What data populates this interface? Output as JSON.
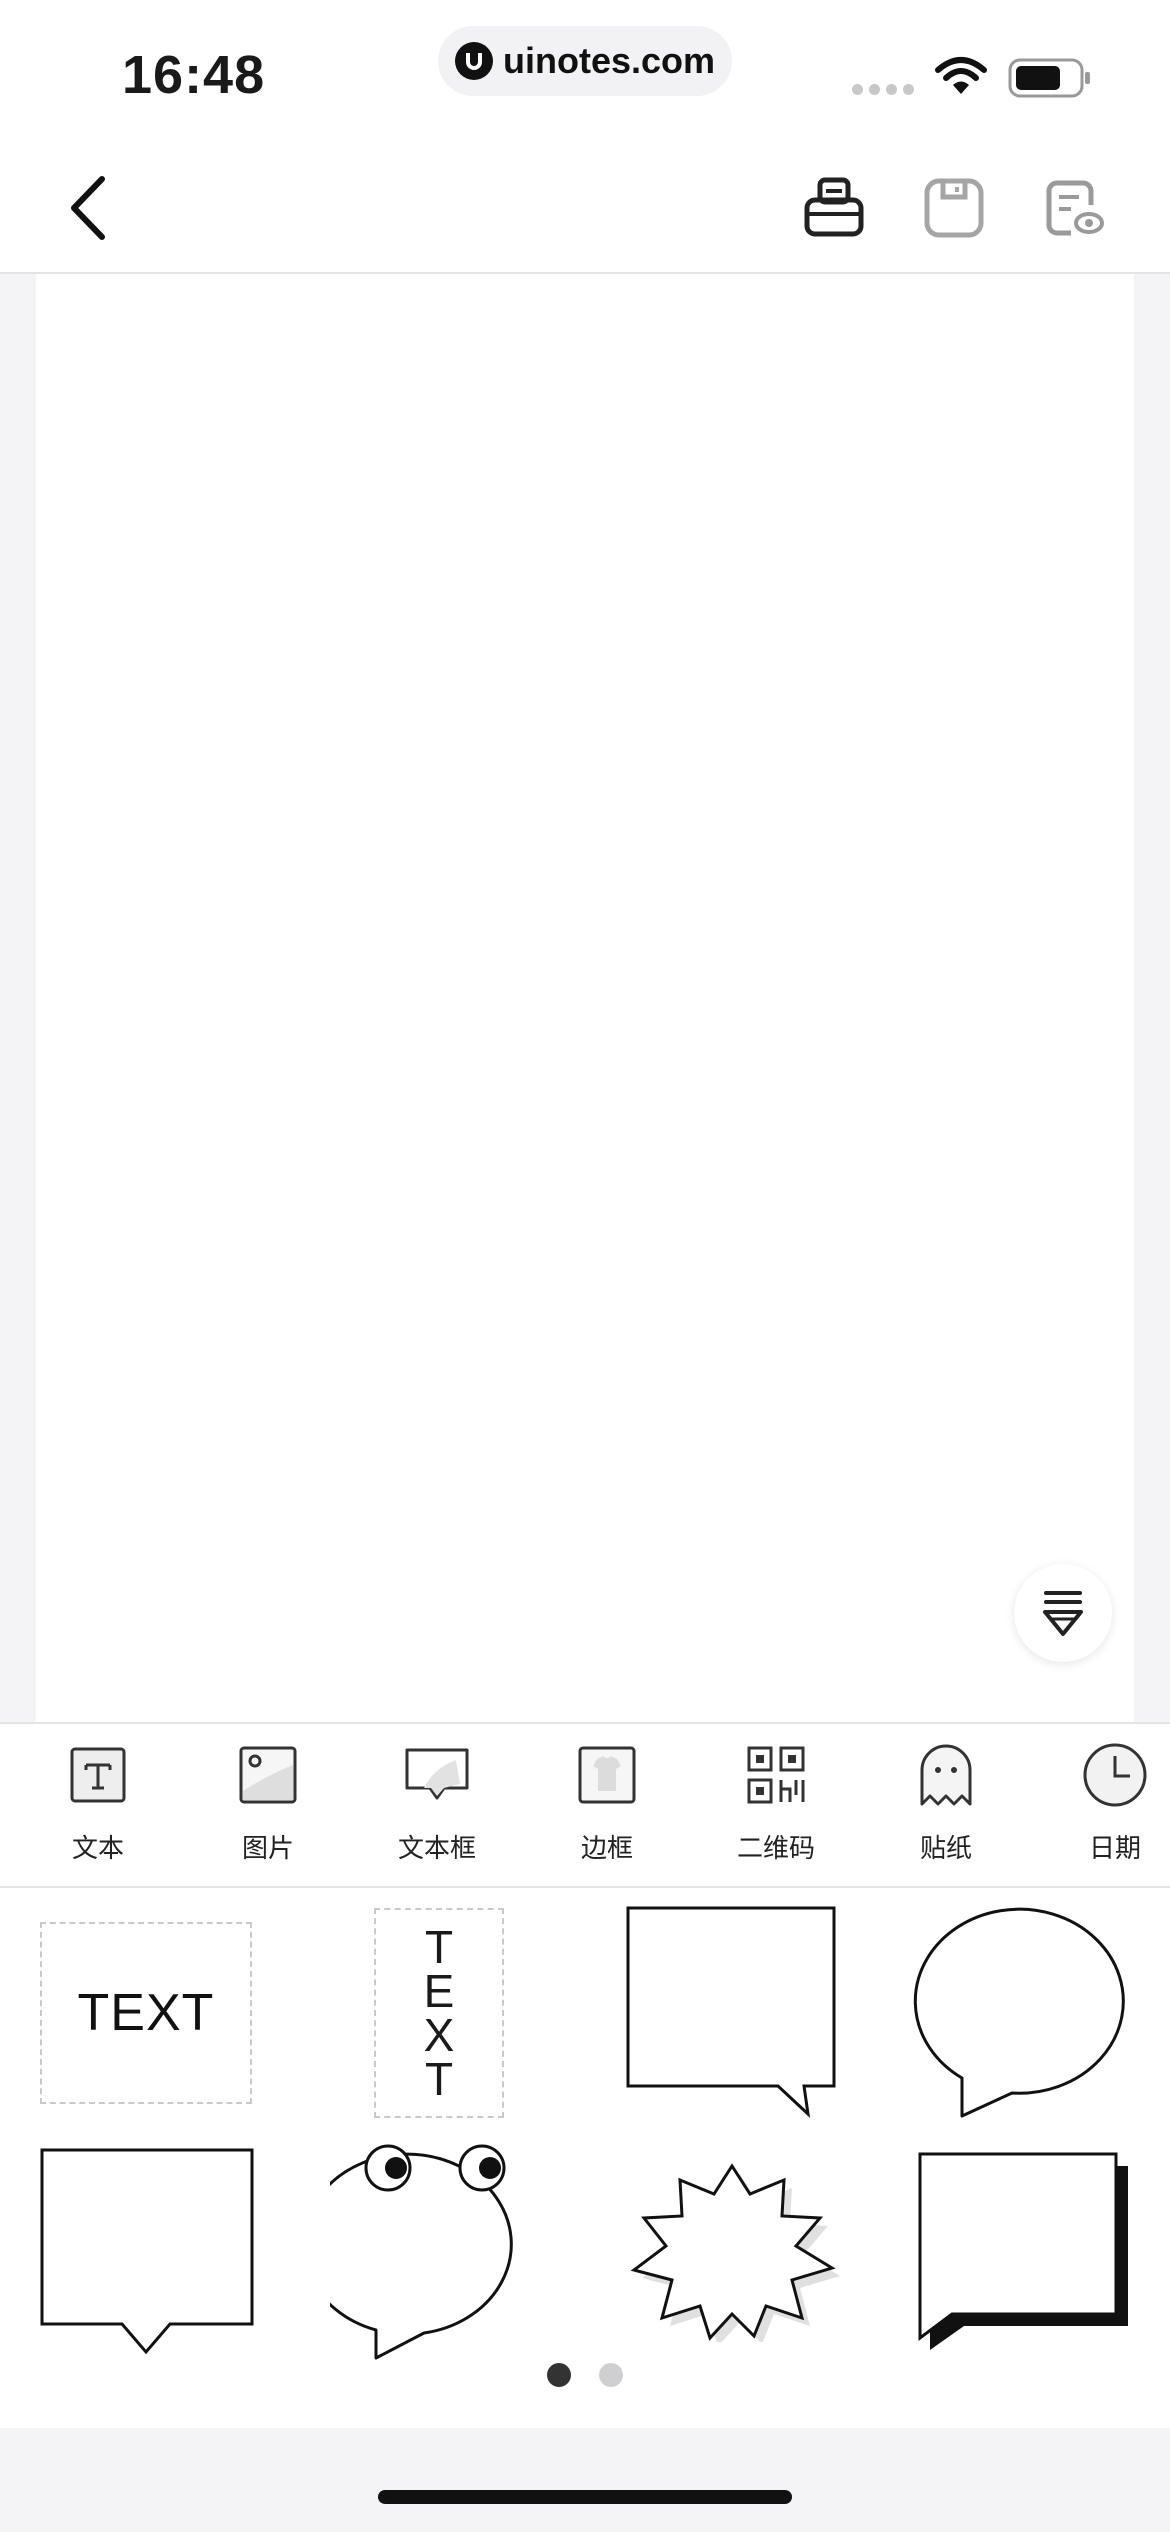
{
  "status_bar": {
    "time": "16:48",
    "url": "uinotes.com"
  },
  "nav": {
    "back_icon": "chevron-left-icon",
    "actions": [
      "printer-icon",
      "save-icon",
      "preview-icon"
    ]
  },
  "canvas": {
    "fab_icon": "layers-icon"
  },
  "toolbar": {
    "items": [
      {
        "label": "文本",
        "icon": "text-icon"
      },
      {
        "label": "图片",
        "icon": "image-icon"
      },
      {
        "label": "文本框",
        "icon": "speech-bubble-icon"
      },
      {
        "label": "边框",
        "icon": "frame-icon"
      },
      {
        "label": "二维码",
        "icon": "qr-code-icon"
      },
      {
        "label": "贴纸",
        "icon": "ghost-sticker-icon"
      },
      {
        "label": "日期",
        "icon": "clock-icon"
      }
    ]
  },
  "shapes": {
    "horizontal_text": "TEXT",
    "vertical_text": [
      "T",
      "E",
      "X",
      "T"
    ],
    "page_count": 2,
    "current_page": 1
  }
}
